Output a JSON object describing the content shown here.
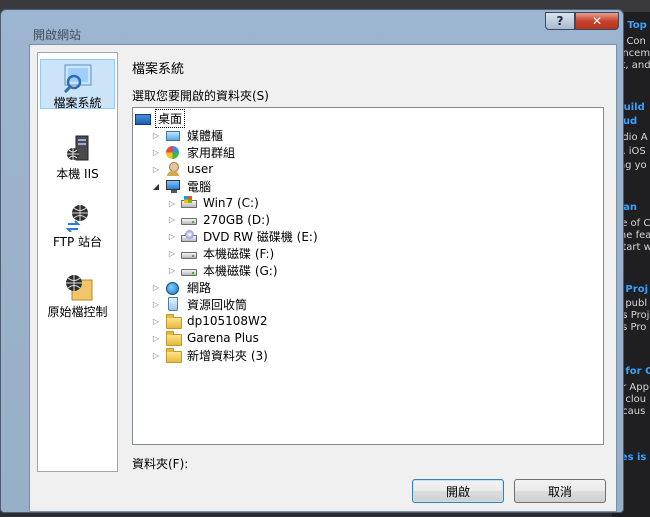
{
  "dialog": {
    "title": "開啟網站",
    "help_label": "?",
    "close_label": "✕"
  },
  "places": [
    {
      "label": "檔案系統",
      "icon": "file-system-icon",
      "selected": true
    },
    {
      "label": "本機 IIS",
      "icon": "local-iis-icon",
      "selected": false
    },
    {
      "label": "FTP 站台",
      "icon": "ftp-site-icon",
      "selected": false
    },
    {
      "label": "原始檔控制",
      "icon": "source-control-icon",
      "selected": false
    }
  ],
  "main": {
    "section_title": "檔案系統",
    "tree_label": "選取您要開啟的資料夾(S)",
    "folder_label": "資料夾(F):",
    "open_button": "開啟",
    "cancel_button": "取消"
  },
  "tree": [
    {
      "label": "桌面",
      "icon": "desktop-icon",
      "depth": 0,
      "expander": "none",
      "selected": true
    },
    {
      "label": "媒體櫃",
      "icon": "libraries-icon",
      "depth": 1,
      "expander": "collapsed"
    },
    {
      "label": "家用群組",
      "icon": "homegroup-icon",
      "depth": 1,
      "expander": "collapsed"
    },
    {
      "label": "user",
      "icon": "user-icon",
      "depth": 1,
      "expander": "collapsed"
    },
    {
      "label": "電腦",
      "icon": "computer-icon",
      "depth": 1,
      "expander": "expanded"
    },
    {
      "label": "Win7 (C:)",
      "icon": "windows-drive-icon",
      "depth": 2,
      "expander": "collapsed"
    },
    {
      "label": "270GB (D:)",
      "icon": "drive-icon",
      "depth": 2,
      "expander": "collapsed"
    },
    {
      "label": "DVD RW 磁碟機 (E:)",
      "icon": "dvd-drive-icon",
      "depth": 2,
      "expander": "collapsed"
    },
    {
      "label": "本機磁碟 (F:)",
      "icon": "drive-icon",
      "depth": 2,
      "expander": "collapsed"
    },
    {
      "label": "本機磁碟 (G:)",
      "icon": "drive-icon",
      "depth": 2,
      "expander": "collapsed"
    },
    {
      "label": "網路",
      "icon": "network-icon",
      "depth": 1,
      "expander": "collapsed"
    },
    {
      "label": "資源回收筒",
      "icon": "recycle-bin-icon",
      "depth": 1,
      "expander": "collapsed"
    },
    {
      "label": "dp105108W2",
      "icon": "folder-icon",
      "depth": 1,
      "expander": "collapsed"
    },
    {
      "label": "Garena Plus",
      "icon": "folder-icon",
      "depth": 1,
      "expander": "collapsed"
    },
    {
      "label": "新增資料夾 (3)",
      "icon": "folder-icon",
      "depth": 1,
      "expander": "collapsed"
    }
  ],
  "background": {
    "lines": [
      {
        "text": "V Top",
        "kind": "head"
      },
      {
        "text": "ft Con",
        "kind": "body"
      },
      {
        "text": "uncem",
        "kind": "body"
      },
      {
        "text": "ct, and",
        "kind": "body"
      },
      {
        "text": "Build",
        "kind": "head"
      },
      {
        "text": "oud",
        "kind": "head"
      },
      {
        "text": "udio A",
        "kind": "body"
      },
      {
        "text": "d, iOS",
        "kind": "body"
      },
      {
        "text": "ing yo",
        "kind": "body"
      },
      {
        "text": "pan",
        "kind": "head"
      },
      {
        "text": "se of C",
        "kind": "body"
      },
      {
        "text": "the fea",
        "kind": "body"
      },
      {
        "text": "Start w",
        "kind": "body"
      },
      {
        "text": "s Proj",
        "kind": "head"
      },
      {
        "text": "e publ",
        "kind": "body"
      },
      {
        "text": "ps Proj",
        "kind": "body"
      },
      {
        "text": "os Pro",
        "kind": "body"
      },
      {
        "text": "s for C",
        "kind": "head"
      },
      {
        "text": "or App",
        "kind": "body"
      },
      {
        "text": "e clou",
        "kind": "body"
      },
      {
        "text": "ecaus",
        "kind": "body"
      },
      {
        "text": "tes is",
        "kind": "head"
      }
    ]
  }
}
